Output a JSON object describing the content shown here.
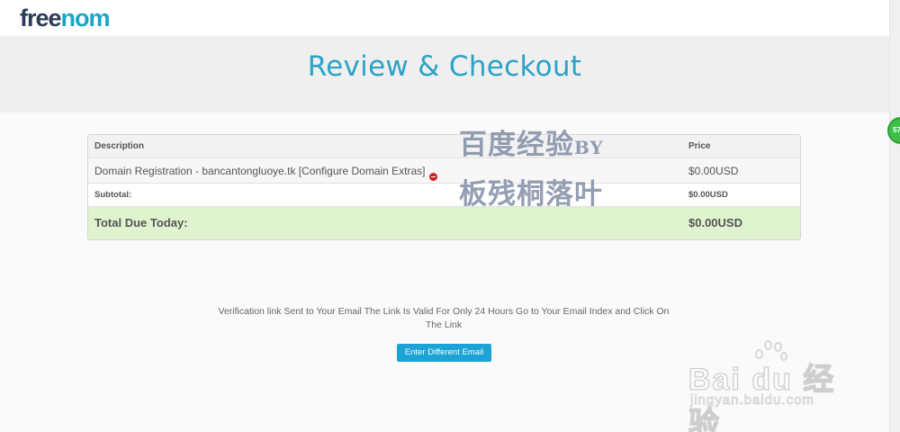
{
  "logo": {
    "part1": "free",
    "part2": "nom"
  },
  "page_title": "Review & Checkout",
  "cart": {
    "headers": {
      "description": "Description",
      "price": "Price"
    },
    "item": {
      "description": "Domain Registration - bancantongluoye.tk [Configure Domain Extras]",
      "price": "$0.00USD",
      "remove_icon": "remove-icon"
    },
    "subtotal": {
      "label": "Subtotal:",
      "value": "$0.00USD"
    },
    "total": {
      "label": "Total Due Today:",
      "value": "$0.00USD"
    }
  },
  "verification": {
    "message": "Verification link Sent to Your Email The Link Is Valid For Only 24 Hours Go to Your Email Index and Click On The Link",
    "button_label": "Enter Different Email"
  },
  "chat_badge": "57",
  "watermark": {
    "line1": "百度经验",
    "line1_suffix": "BY",
    "line2": "板残桐落叶",
    "baidu_logo": "Bai du 经验",
    "baidu_url": "jingyan.baidu.com"
  },
  "colors": {
    "accent": "#2ba3c6",
    "button": "#1ba3d6",
    "total_bg": "#dff3cf",
    "remove": "#cc2222"
  }
}
